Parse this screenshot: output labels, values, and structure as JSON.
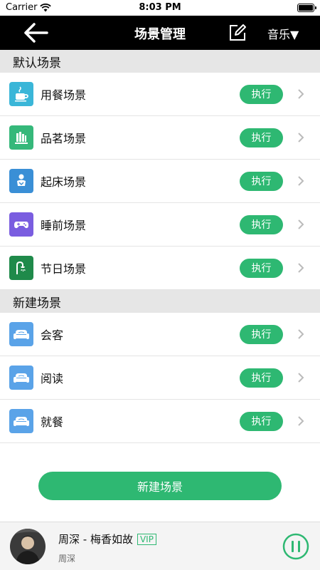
{
  "status_bar": {
    "carrier": "Carrier",
    "time": "8:03 PM"
  },
  "nav": {
    "title": "场景管理",
    "music_label": "音乐▼"
  },
  "sections": {
    "default": {
      "header": "默认场景",
      "items": [
        {
          "label": "用餐场景",
          "action": "执行",
          "icon": "coffee-cup-icon",
          "color": "#3ab6d8"
        },
        {
          "label": "品茗场景",
          "action": "执行",
          "icon": "books-icon",
          "color": "#35b87a"
        },
        {
          "label": "起床场景",
          "action": "执行",
          "icon": "baby-icon",
          "color": "#3a8fd6"
        },
        {
          "label": "睡前场景",
          "action": "执行",
          "icon": "gamepad-icon",
          "color": "#7a5de0"
        },
        {
          "label": "节日场景",
          "action": "执行",
          "icon": "shower-icon",
          "color": "#1f8a4a"
        }
      ]
    },
    "custom": {
      "header": "新建场景",
      "items": [
        {
          "label": "会客",
          "action": "执行",
          "icon": "sofa-icon",
          "color": "#5aa3e8"
        },
        {
          "label": "阅读",
          "action": "执行",
          "icon": "sofa-icon",
          "color": "#5aa3e8"
        },
        {
          "label": "就餐",
          "action": "执行",
          "icon": "sofa-icon",
          "color": "#5aa3e8"
        }
      ]
    }
  },
  "new_scene_button": "新建场景",
  "player": {
    "song": "周深 - 梅香如故",
    "badge": "VIP",
    "artist": "周深"
  },
  "colors": {
    "accent": "#2eb872",
    "nav_bg": "#000000",
    "section_bg": "#e6e6e6"
  }
}
